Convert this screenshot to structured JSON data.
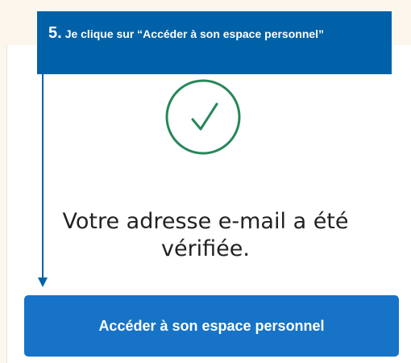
{
  "callout": {
    "step_number": "5.",
    "text": "Je clique sur “Accéder à son espace personnel”"
  },
  "verification": {
    "icon": "check-circle-icon",
    "message": "Votre adresse e-mail a été vérifiée."
  },
  "cta": {
    "label": "Accéder à son espace personnel"
  },
  "colors": {
    "callout_bg": "#0061a8",
    "button_bg": "#1673c7",
    "check_green": "#27875a",
    "page_bg": "#fdf6ec"
  }
}
